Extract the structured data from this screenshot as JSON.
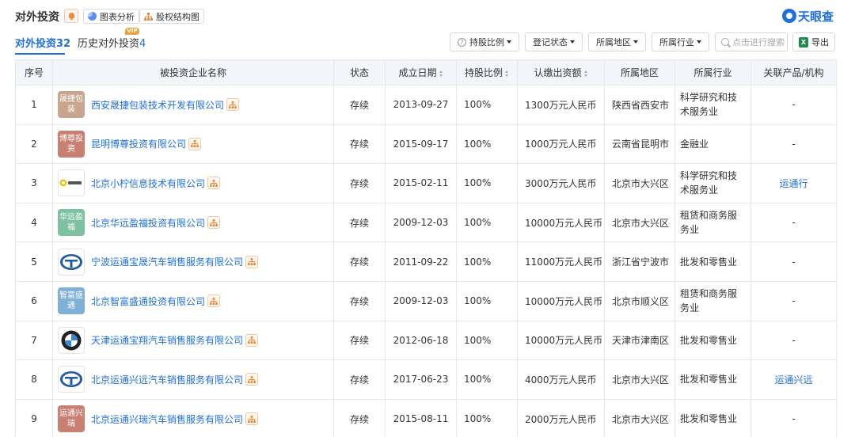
{
  "header": {
    "title": "对外投资",
    "chart_btn": "图表分析",
    "equity_btn": "股权结构图",
    "brand": "天眼查",
    "colors": {
      "accent": "#1e6fe0",
      "status_green": "#25a048",
      "vip": "#e8a13b"
    }
  },
  "tabs": {
    "active_label": "对外投资",
    "active_count": "32",
    "history_label": "历史对外投资",
    "history_count": "4",
    "vip": "VIP"
  },
  "filters": {
    "ratio": "持股比例",
    "reg_status": "登记状态",
    "region": "所属地区",
    "industry": "所属行业",
    "search_placeholder": "点击进行搜索",
    "export": "导出"
  },
  "table": {
    "headers": {
      "idx": "序号",
      "name": "被投资企业名称",
      "status": "状态",
      "date": "成立日期",
      "ratio": "持股比例",
      "capital": "认缴出资额",
      "region": "所属地区",
      "industry": "所属行业",
      "related": "关联产品/机构"
    },
    "rows": [
      {
        "idx": "1",
        "logo_text": "晟捷包装",
        "logo_color": "#c9a48f",
        "name": "西安晟捷包装技术开发有限公司",
        "status": "存续",
        "date": "2013-09-27",
        "ratio": "100%",
        "capital": "1300万元人民币",
        "region": "陕西省西安市",
        "industry": "科学研究和技术服务业",
        "related": "-"
      },
      {
        "idx": "2",
        "logo_text": "博尊投资",
        "logo_color": "#c98073",
        "name": "昆明博尊投资有限公司",
        "status": "存续",
        "date": "2015-09-17",
        "ratio": "100%",
        "capital": "1000万元人民币",
        "region": "云南省昆明市",
        "industry": "金融业",
        "related": "-"
      },
      {
        "idx": "3",
        "logo_text": "",
        "logo_color": "",
        "logo_icon": "lemon-logo-icon",
        "name": "北京小柠信息技术有限公司",
        "status": "存续",
        "date": "2015-02-11",
        "ratio": "100%",
        "capital": "3000万元人民币",
        "region": "北京市大兴区",
        "industry": "科学研究和技术服务业",
        "related": "运通行"
      },
      {
        "idx": "4",
        "logo_text": "华远盈福",
        "logo_color": "#7cc1a0",
        "name": "北京华远盈福投资有限公司",
        "status": "存续",
        "date": "2009-12-03",
        "ratio": "100%",
        "capital": "10000万元人民币",
        "region": "北京市大兴区",
        "industry": "租赁和商务服务业",
        "related": "-"
      },
      {
        "idx": "5",
        "logo_text": "",
        "logo_color": "",
        "logo_icon": "yuntong-logo-icon",
        "name": "宁波运通宝晟汽车销售服务有限公司",
        "status": "存续",
        "date": "2011-09-22",
        "ratio": "100%",
        "capital": "11000万元人民币",
        "region": "浙江省宁波市",
        "industry": "批发和零售业",
        "related": "-"
      },
      {
        "idx": "6",
        "logo_text": "智富盛通",
        "logo_color": "#7fb0d6",
        "name": "北京智富盛通投资有限公司",
        "status": "存续",
        "date": "2009-12-03",
        "ratio": "100%",
        "capital": "10000万元人民币",
        "region": "北京市顺义区",
        "industry": "租赁和商务服务业",
        "related": "-"
      },
      {
        "idx": "7",
        "logo_text": "",
        "logo_color": "",
        "logo_icon": "bmw-logo-icon",
        "name": "天津运通宝翔汽车销售服务有限公司",
        "status": "存续",
        "date": "2012-06-18",
        "ratio": "100%",
        "capital": "10000万元人民币",
        "region": "天津市津南区",
        "industry": "批发和零售业",
        "related": "-"
      },
      {
        "idx": "8",
        "logo_text": "",
        "logo_color": "",
        "logo_icon": "yuntong-logo-icon",
        "name": "北京运通兴远汽车销售服务有限公司",
        "status": "存续",
        "date": "2017-06-23",
        "ratio": "100%",
        "capital": "4000万元人民币",
        "region": "北京市大兴区",
        "industry": "批发和零售业",
        "related": "运通兴远"
      },
      {
        "idx": "9",
        "logo_text": "运通兴瑞",
        "logo_color": "#c98073",
        "name": "北京运通兴瑞汽车销售服务有限公司",
        "status": "存续",
        "date": "2015-08-11",
        "ratio": "100%",
        "capital": "2000万元人民币",
        "region": "北京市大兴区",
        "industry": "批发和零售业",
        "related": "-"
      }
    ]
  }
}
